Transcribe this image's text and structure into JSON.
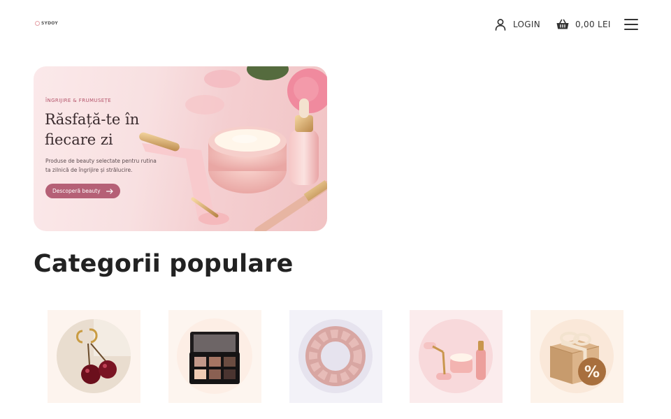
{
  "header": {
    "logo_text": "SYDOY",
    "login_label": "LOGIN",
    "cart_total": "0,00 LEI",
    "icons": [
      "user-icon",
      "basket-icon",
      "hamburger-menu-icon"
    ]
  },
  "hero": {
    "eyebrow": "ÎNGRIJIRE & FRUMUSEȚE",
    "title": "Răsfață-te în fiecare zi",
    "description": "Produse de beauty selectate pentru rutina ta zilnică de îngrijire și strălucire.",
    "cta_label": "Descoperă beauty",
    "accent_color": "#b56076"
  },
  "categories": {
    "title": "Categorii populare",
    "items": [
      {
        "icon": "cherry-earrings-image"
      },
      {
        "icon": "eyeshadow-palette-image"
      },
      {
        "icon": "scrunchie-image"
      },
      {
        "icon": "skincare-set-image"
      },
      {
        "icon": "gift-box-discount-image"
      }
    ]
  }
}
